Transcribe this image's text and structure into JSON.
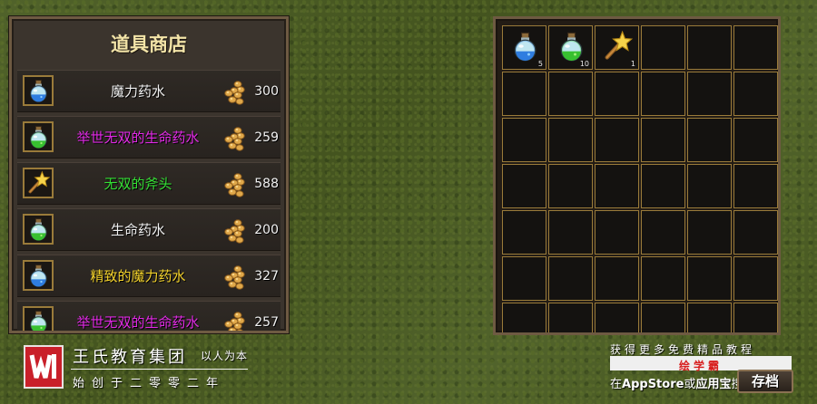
{
  "shop": {
    "title": "道具商店",
    "items": [
      {
        "name": "魔力药水",
        "price": "300",
        "color": "#f1f1f1",
        "icon": "blue-potion-icon"
      },
      {
        "name": "举世无双的生命药水",
        "price": "259",
        "color": "#e22ae6",
        "icon": "green-potion-icon"
      },
      {
        "name": "无双的斧头",
        "price": "588",
        "color": "#35e035",
        "icon": "star-wand-icon"
      },
      {
        "name": "生命药水",
        "price": "200",
        "color": "#f1f1f1",
        "icon": "green-potion-icon"
      },
      {
        "name": "精致的魔力药水",
        "price": "327",
        "color": "#f3d22b",
        "icon": "blue-potion-icon"
      },
      {
        "name": "举世无双的生命药水",
        "price": "257",
        "color": "#e22ae6",
        "icon": "green-potion-icon"
      }
    ]
  },
  "inventory": {
    "slots": [
      {
        "icon": "blue-potion-icon",
        "qty": "5"
      },
      {
        "icon": "green-potion-icon",
        "qty": "10"
      },
      {
        "icon": "star-wand-icon",
        "qty": "1"
      }
    ],
    "total_slots": 42
  },
  "watermark": {
    "company": "王氏教育集团",
    "motto": "以人为本",
    "since": "始创于二零零二年"
  },
  "promo": {
    "line1": "获得更多免费精品教程",
    "brand": "绘学霸",
    "line2_prefix": "在",
    "appstore": "AppStore",
    "line2_mid": "或",
    "yingyongbao": "应用宝",
    "line2_suffix": "搜"
  },
  "save_button": {
    "label": "存档"
  }
}
